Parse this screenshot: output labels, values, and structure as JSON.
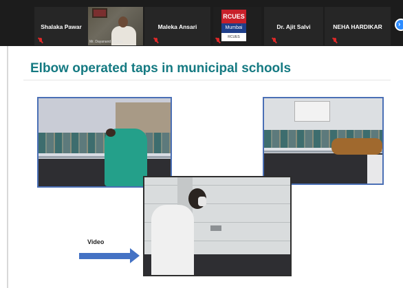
{
  "participants": [
    {
      "name": "Shalaka Pawar",
      "muted": true
    },
    {
      "name": "",
      "video_caption": "Mr. Dayanand Jadhav",
      "muted": true
    },
    {
      "name": "Maleka Ansari",
      "muted": true
    },
    {
      "name": "",
      "logo": {
        "top": "RCUES",
        "mid": "Mumbai",
        "bottom": "RCUES"
      },
      "muted": true
    },
    {
      "name": "Dr. Ajit Salvi",
      "muted": true
    },
    {
      "name": "NEHA HARDIKAR",
      "muted": true
    }
  ],
  "nav": {
    "next_glyph": "›"
  },
  "slide": {
    "title": "Elbow operated taps in municipal schools",
    "video_label": "Video"
  },
  "colors": {
    "title": "#157a82",
    "arrow": "#4472c4",
    "muted_mic": "#e02828",
    "zoom_blue": "#2d8cff"
  }
}
